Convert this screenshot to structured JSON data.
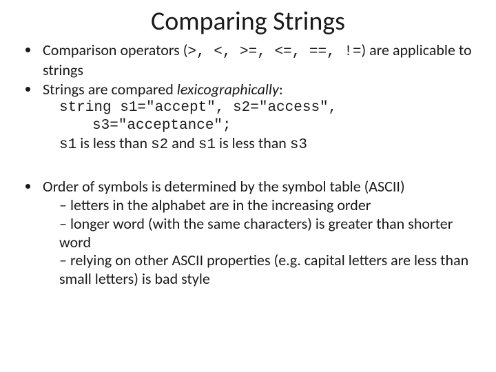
{
  "title": "Comparing Strings",
  "bullets": {
    "b1": {
      "prefix": "Comparison operators (",
      "ops": ">, <, >=, <=, ==, !=",
      "suffix": ") are applicable to strings"
    },
    "b2": {
      "lead": "Strings are compared ",
      "lexico": "lexicographically",
      "colon": ":",
      "code1": "string s1=\"accept\", s2=\"access\",",
      "code2": "s3=\"acceptance\";",
      "cmp": {
        "s1a": "s1",
        "t1": " is less than ",
        "s2": "s2",
        "t2": " and ",
        "s1b": "s1",
        "t3": " is less than ",
        "s3": "s3"
      }
    },
    "b3": {
      "text": "Order of symbols is determined by the symbol table (ASCII)",
      "sub1": "letters in the alphabet are in the increasing order",
      "sub2": "longer word (with the same characters) is greater than shorter word",
      "sub3": "relying on other ASCII properties (e.g. capital letters are less than small letters) is bad style"
    }
  }
}
